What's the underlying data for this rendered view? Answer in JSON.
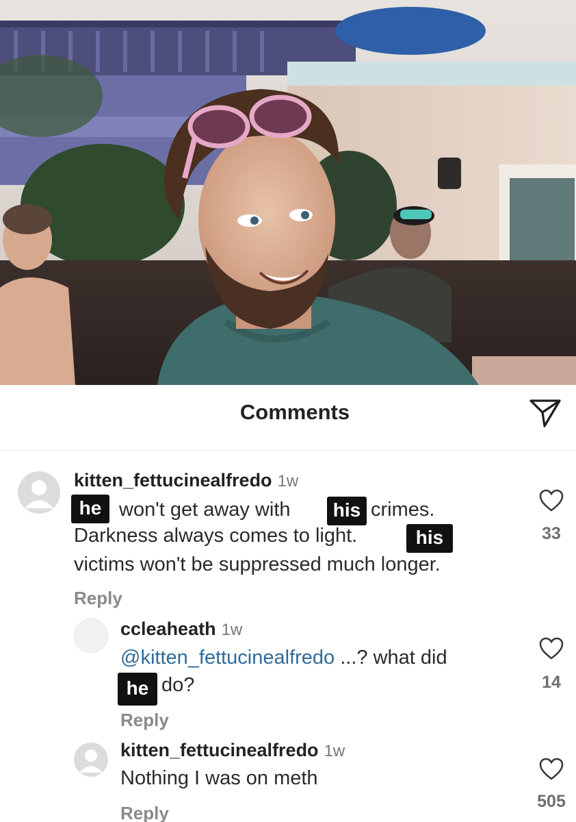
{
  "header": {
    "title": "Comments",
    "share_icon": "paper-plane-icon"
  },
  "comments": [
    {
      "username": "kitten_fettucinealfredo",
      "time": "1w",
      "lines": [
        "won't get away with",
        "crimes.",
        "Darkness always comes to light.",
        "victims won't be suppressed much longer."
      ],
      "redactions": [
        "he",
        "his",
        "his"
      ],
      "reply_label": "Reply",
      "likes": "33"
    },
    {
      "username": "ccleaheath",
      "time": "1w",
      "mention": "@kitten_fettucinealfredo",
      "lines": [
        "...? what did",
        "do?"
      ],
      "redactions": [
        "he"
      ],
      "reply_label": "Reply",
      "likes": "14"
    },
    {
      "username": "kitten_fettucinealfredo",
      "time": "1w",
      "lines": [
        "Nothing I was on meth"
      ],
      "reply_label": "Reply",
      "likes": "505"
    }
  ],
  "colors": {
    "mention": "#2f6b9a",
    "censor_box": "#111111",
    "teal_shirt": "#3f6d6b"
  }
}
